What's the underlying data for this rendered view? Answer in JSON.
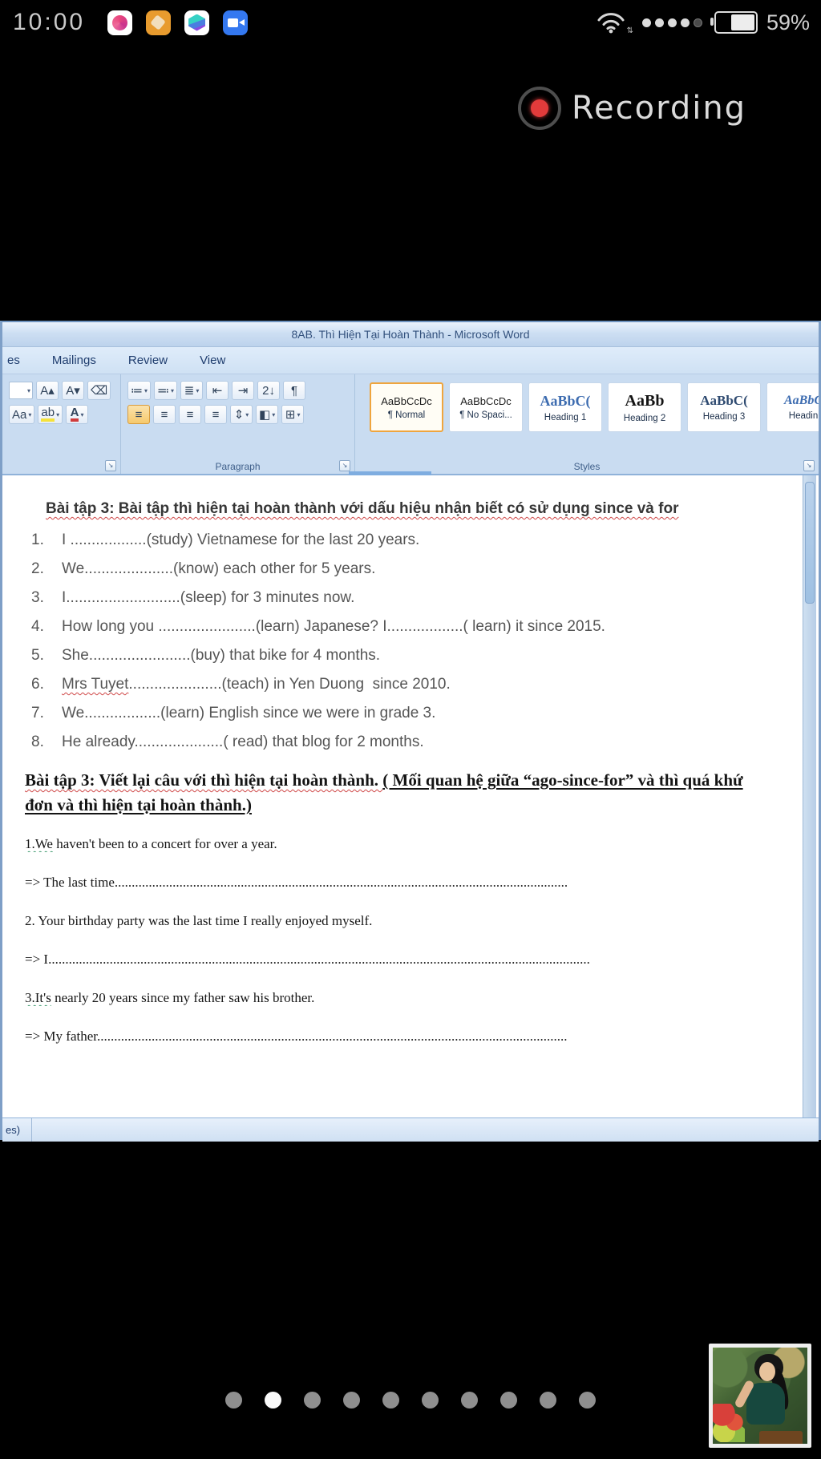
{
  "status_bar": {
    "time": "10:00",
    "battery_percent": "59%",
    "app_icons": [
      "pink-media-app",
      "orange-app",
      "multicolor-hex-app",
      "zoom-video-app"
    ],
    "signal": {
      "filled_dots": 4,
      "total_dots": 5
    },
    "wifi_arrows": "⇅"
  },
  "recording": {
    "label": "Recording"
  },
  "icons": {
    "dropdown": "▾",
    "grow_font": "A▴",
    "shrink_font": "A▾",
    "clear_format": "⌫",
    "change_case": "Aa",
    "highlight": "ab",
    "font_color": "A",
    "bullets": "≔",
    "numbering": "≕",
    "multilevel": "≣",
    "outdent": "⇤",
    "indent": "⇥",
    "sort": "2↓",
    "pilcrow": "¶",
    "align": "≡",
    "line_spacing": "⇕",
    "shading": "◧",
    "borders": "⊞",
    "launcher": "↘"
  },
  "word": {
    "title": "8AB.  Thì Hiện Tại Hoàn Thành  -  Microsoft Word",
    "tabs": [
      {
        "label": "es"
      },
      {
        "label": "Mailings"
      },
      {
        "label": "Review"
      },
      {
        "label": "View"
      }
    ],
    "ribbon": {
      "groups": {
        "paragraph": "Paragraph",
        "styles": "Styles"
      },
      "styles": [
        {
          "sample": "AaBbCcDc",
          "label": "¶ Normal",
          "selected": true
        },
        {
          "sample": "AaBbCcDc",
          "label": "¶ No Spaci...",
          "selected": false
        },
        {
          "sample": "AaBbC(",
          "label": "Heading 1",
          "selected": false
        },
        {
          "sample": "AaBb",
          "label": "Heading 2",
          "selected": false
        },
        {
          "sample": "AaBbC(",
          "label": "Heading 3",
          "selected": false
        },
        {
          "sample": "AaBbC",
          "label": "Headin",
          "selected": false
        }
      ]
    },
    "document": {
      "heading1": "Bài tập 3: Bài tập thì hiện tại hoàn thành với dấu hiệu nhận biết có sử dụng since và for",
      "ex1": [
        {
          "num": "1.",
          "text": "I ..................(study) Vietnamese for the last 20 years."
        },
        {
          "num": "2.",
          "text": "We.....................(know) each other for 5 years."
        },
        {
          "num": "3.",
          "text": "I...........................(sleep) for 3 minutes now."
        },
        {
          "num": "4.",
          "text": "How long you .......................(learn) Japanese? I..................( learn) it since 2015."
        },
        {
          "num": "5.",
          "text": "She........................(buy) that bike for 4 months."
        },
        {
          "num": "6.",
          "lead": "Mrs Tuyet",
          "rest": "......................(teach) in Yen Duong  since 2010."
        },
        {
          "num": "7.",
          "text": "We..................(learn) English since we were in grade 3."
        },
        {
          "num": "8.",
          "text": "He already.....................( read) that blog for 2 months."
        }
      ],
      "heading2_main": "Bài tập 3: Viết lại câu với thì hiện tại hoàn thành. ",
      "heading2_note": "( Mối quan hệ giữa “ago-since-for” và thì quá khứ đơn và thì hiện tại hoàn thành.)",
      "ex2": [
        {
          "lead": "1.We",
          "rest": " haven't been to a concert for over a year."
        },
        {
          "text": "=> The last time....................................................................................................................................."
        },
        {
          "text": "2. Your birthday party was the last time I really enjoyed myself."
        },
        {
          "text": "=> I..............................................................................................................................................................."
        },
        {
          "lead": "3.It's",
          "rest": " nearly 20 years since my father saw his brother."
        },
        {
          "text": "=> My father.........................................................................................................................................."
        }
      ]
    },
    "status_left": "es)"
  },
  "pager": {
    "dots": [
      "dot",
      "dot",
      "dot",
      "dot",
      "dot",
      "dot",
      "dot",
      "dot",
      "dot",
      "dot"
    ],
    "active_index": 1
  },
  "colors": {
    "recording_red": "#e23b3b",
    "active_style_border": "#efa53e",
    "align_active_orange": "#f6c96d",
    "highlight_yellow": "#f5e23a",
    "font_color_red": "#d03b3b",
    "selection_blue": "#7fade0",
    "ribbon_blue": "#c9dcf1",
    "squiggle_red": "#cf4747"
  }
}
